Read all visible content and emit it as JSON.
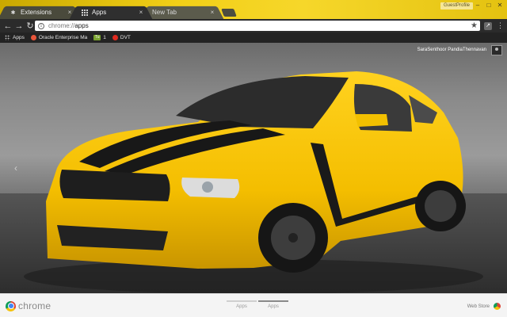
{
  "tabs": [
    {
      "title": "Extensions",
      "icon": "puzzle-icon",
      "active": false
    },
    {
      "title": "Apps",
      "icon": "apps-grid-icon",
      "active": true
    },
    {
      "title": "New Tab",
      "icon": "",
      "active": false
    }
  ],
  "window": {
    "profile_label": "GuestProfile"
  },
  "toolbar": {
    "url_scheme": "chrome://",
    "url_path": "apps"
  },
  "bookmarks": [
    {
      "label": "Apps",
      "icon": "apps-grid-icon"
    },
    {
      "label": "Oracle Enterprise Ma",
      "icon": "oracle-icon"
    },
    {
      "label": "1",
      "icon": "tu-icon",
      "icon_text": "Tu"
    },
    {
      "label": "DVT",
      "icon": "youtube-icon"
    }
  ],
  "theme": {
    "user_name": "SaraSenthoor PandiaThennavan",
    "car_color": "#f5c400",
    "stripe_color": "#1a1a1a"
  },
  "launcher": {
    "brand": "chrome",
    "page_tabs": [
      "Apps",
      "Apps"
    ],
    "webstore_label": "Web Store"
  }
}
